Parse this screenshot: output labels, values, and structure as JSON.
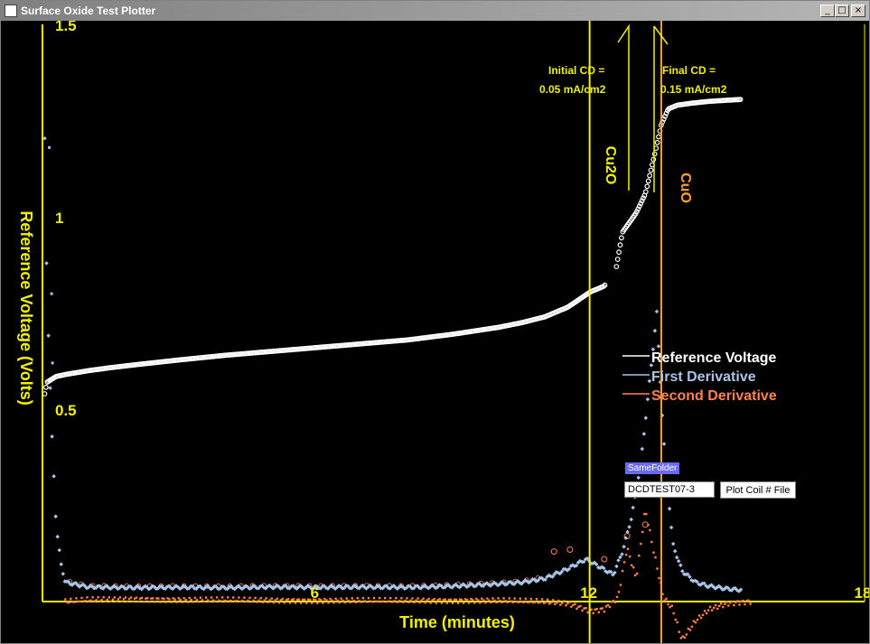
{
  "window": {
    "title": "Surface Oxide Test Plotter",
    "minimize_glyph": "_",
    "maximize_glyph": "□",
    "close_glyph": "×"
  },
  "controls": {
    "folder_label": "SameFolder",
    "file_value": "DCDTEST07-3",
    "plot_button": "Plot Coil # File"
  },
  "annotations": {
    "initial_cd_line1": "Initial CD =",
    "initial_cd_line2": "0.05 mA/cm2",
    "final_cd_line1": "Final CD =",
    "final_cd_line2": "0.15 mA/cm2",
    "cu2o": "Cu2O",
    "cuo": "CuO"
  },
  "colors": {
    "axis": "#f0f000",
    "reference": "#ffffff",
    "first": "#a9c4e8",
    "second": "#ff8050",
    "cu2o_line": "#f0f000",
    "cuo_line": "#ffa030"
  },
  "chart_data": {
    "type": "scatter",
    "xlabel": "Time (minutes)",
    "ylabel": "Reference Voltage (Volts)",
    "xlim": [
      0,
      18
    ],
    "ylim": [
      0,
      1.5
    ],
    "x_ticks": [
      "6",
      "12",
      "18"
    ],
    "y_ticks": [
      "0.5",
      "1",
      "1.5"
    ],
    "legend": [
      "Reference Voltage",
      "First Derivative",
      "Second Derivative"
    ],
    "legend_position": "right",
    "grid": false,
    "vertical_markers": [
      {
        "x": 11.98,
        "label": "Cu2O"
      },
      {
        "x": 13.55,
        "label": "CuO"
      }
    ],
    "series": [
      {
        "name": "Reference Voltage",
        "x": [
          0.05,
          0.1,
          0.3,
          0.5,
          1.0,
          1.5,
          2.0,
          3.0,
          4.0,
          5.0,
          6.0,
          7.0,
          8.0,
          9.0,
          10.0,
          10.5,
          11.0,
          11.5,
          12.0,
          12.3,
          12.55,
          12.7,
          12.85,
          13.0,
          13.2,
          13.4,
          13.55,
          13.7,
          13.9,
          14.2,
          14.6,
          15.0,
          15.3
        ],
        "y": [
          0.54,
          0.57,
          0.585,
          0.59,
          0.6,
          0.608,
          0.615,
          0.628,
          0.64,
          0.65,
          0.66,
          0.67,
          0.68,
          0.695,
          0.713,
          0.725,
          0.74,
          0.765,
          0.805,
          0.82,
          0.86,
          0.96,
          0.985,
          1.01,
          1.06,
          1.16,
          1.24,
          1.28,
          1.29,
          1.295,
          1.3,
          1.303,
          1.305
        ]
      },
      {
        "name": "First Derivative",
        "x": [
          0.05,
          0.1,
          0.2,
          0.3,
          0.4,
          0.5,
          1,
          2,
          3,
          4,
          5,
          6,
          7,
          8,
          9,
          10,
          10.5,
          11,
          11.5,
          11.9,
          12.2,
          12.5,
          12.7,
          12.9,
          13.1,
          13.3,
          13.45,
          13.6,
          13.8,
          14,
          14.3,
          14.6,
          15,
          15.3
        ],
        "y": [
          1.2,
          0.8,
          0.45,
          0.2,
          0.1,
          0.05,
          0.038,
          0.036,
          0.037,
          0.036,
          0.038,
          0.037,
          0.038,
          0.037,
          0.04,
          0.046,
          0.05,
          0.06,
          0.085,
          0.11,
          0.09,
          0.07,
          0.13,
          0.22,
          0.36,
          0.58,
          0.75,
          0.42,
          0.15,
          0.08,
          0.05,
          0.04,
          0.033,
          0.03
        ]
      },
      {
        "name": "Second Derivative",
        "x": [
          0.5,
          1,
          2,
          3,
          4,
          5,
          6,
          7,
          8,
          9,
          10,
          11,
          11.5,
          12,
          12.3,
          12.6,
          12.8,
          13.0,
          13.2,
          13.4,
          13.6,
          13.8,
          14.0,
          14.3,
          14.6,
          15.0,
          15.5
        ],
        "y": [
          0.0,
          0.005,
          0.006,
          0.004,
          0.005,
          0.003,
          0.002,
          0.003,
          0.003,
          0.002,
          0.003,
          0.0,
          -0.005,
          -0.025,
          -0.02,
          0.01,
          0.14,
          0.06,
          0.24,
          0.12,
          0.01,
          -0.02,
          -0.1,
          -0.05,
          -0.02,
          -0.005,
          0.0
        ]
      }
    ]
  }
}
